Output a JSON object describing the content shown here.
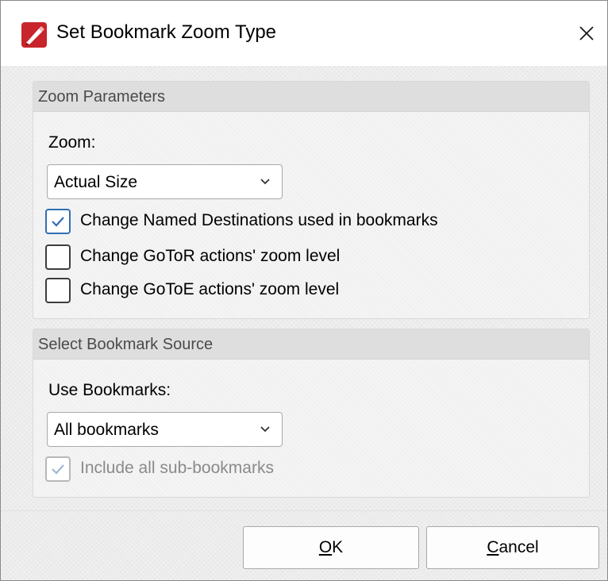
{
  "window": {
    "title": "Set Bookmark Zoom Type",
    "app_icon": "pdf-editor-icon",
    "close_icon": "close-icon"
  },
  "zoom_group": {
    "header": "Zoom Parameters",
    "zoom_label": "Zoom:",
    "zoom_value": "Actual Size",
    "options": [
      {
        "label": "Change Named Destinations used in bookmarks",
        "checked": true,
        "enabled": true
      },
      {
        "label": "Change GoToR actions' zoom level",
        "checked": false,
        "enabled": true
      },
      {
        "label": "Change GoToE actions' zoom level",
        "checked": false,
        "enabled": true
      }
    ]
  },
  "source_group": {
    "header": "Select Bookmark Source",
    "bookmarks_label": "Use Bookmarks:",
    "bookmarks_value": "All bookmarks",
    "include_sub": {
      "label": "Include all sub-bookmarks",
      "checked": true,
      "enabled": false
    }
  },
  "buttons": {
    "ok_mnemonic": "O",
    "ok_rest": "K",
    "cancel_mnemonic": "C",
    "cancel_rest": "ancel"
  },
  "colors": {
    "accent": "#2f6fb3",
    "icon_red": "#c8242b"
  }
}
